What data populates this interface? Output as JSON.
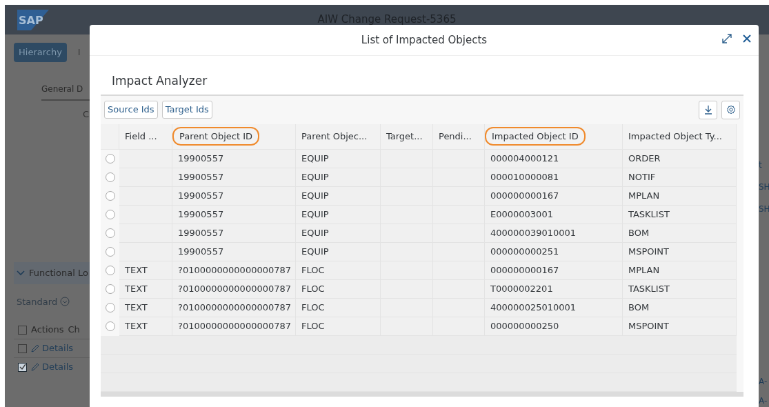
{
  "app": {
    "logo": "SAP",
    "title": "AIW Change Request-5365",
    "tabs": [
      {
        "label": "Hierarchy",
        "selected": true
      },
      {
        "label": "I",
        "selected": false
      }
    ],
    "section_tab": "General D",
    "field_label": "C",
    "panel": {
      "title": "Functional Lo",
      "expanded": true,
      "variant": "Standard",
      "all_checked": false,
      "columns": [
        "Actions",
        "Ch"
      ],
      "rows": [
        {
          "action": "Details",
          "checked": false
        },
        {
          "action": "Details",
          "checked": true
        }
      ]
    },
    "right_fragments": [
      "t",
      "SH",
      "SH",
      "A-",
      "A-"
    ]
  },
  "dialog": {
    "title": "List of Impacted Objects",
    "section": "Impact Analyzer",
    "toolbar_buttons": [
      "Source Ids",
      "Target Ids"
    ],
    "table": {
      "columns": [
        {
          "label": "Field ...",
          "highlighted": false
        },
        {
          "label": "Parent Object ID",
          "highlighted": true
        },
        {
          "label": "Parent Objec...",
          "highlighted": false
        },
        {
          "label": "Target...",
          "highlighted": false
        },
        {
          "label": "Pendi...",
          "highlighted": false
        },
        {
          "label": "Impacted Object ID",
          "highlighted": true
        },
        {
          "label": "Impacted Object Ty...",
          "highlighted": false
        }
      ],
      "rows": [
        {
          "selected": false,
          "cells": [
            "",
            "19900557",
            "EQUIP",
            "",
            "",
            "000004000121",
            "ORDER"
          ]
        },
        {
          "selected": false,
          "cells": [
            "",
            "19900557",
            "EQUIP",
            "",
            "",
            "000010000081",
            "NOTIF"
          ]
        },
        {
          "selected": false,
          "cells": [
            "",
            "19900557",
            "EQUIP",
            "",
            "",
            "000000000167",
            "MPLAN"
          ]
        },
        {
          "selected": false,
          "cells": [
            "",
            "19900557",
            "EQUIP",
            "",
            "",
            "E0000003001",
            "TASKLIST"
          ]
        },
        {
          "selected": false,
          "cells": [
            "",
            "19900557",
            "EQUIP",
            "",
            "",
            "400000039010001",
            "BOM"
          ]
        },
        {
          "selected": false,
          "cells": [
            "",
            "19900557",
            "EQUIP",
            "",
            "",
            "000000000251",
            "MSPOINT"
          ]
        },
        {
          "selected": false,
          "cells": [
            "TEXT",
            "?0100000000000000787",
            "FLOC",
            "",
            "",
            "000000000167",
            "MPLAN"
          ]
        },
        {
          "selected": false,
          "cells": [
            "TEXT",
            "?0100000000000000787",
            "FLOC",
            "",
            "",
            "T0000002201",
            "TASKLIST"
          ]
        },
        {
          "selected": false,
          "cells": [
            "TEXT",
            "?0100000000000000787",
            "FLOC",
            "",
            "",
            "400000025010001",
            "BOM"
          ]
        },
        {
          "selected": false,
          "cells": [
            "TEXT",
            "?0100000000000000787",
            "FLOC",
            "",
            "",
            "000000000250",
            "MSPOINT"
          ]
        }
      ]
    }
  }
}
